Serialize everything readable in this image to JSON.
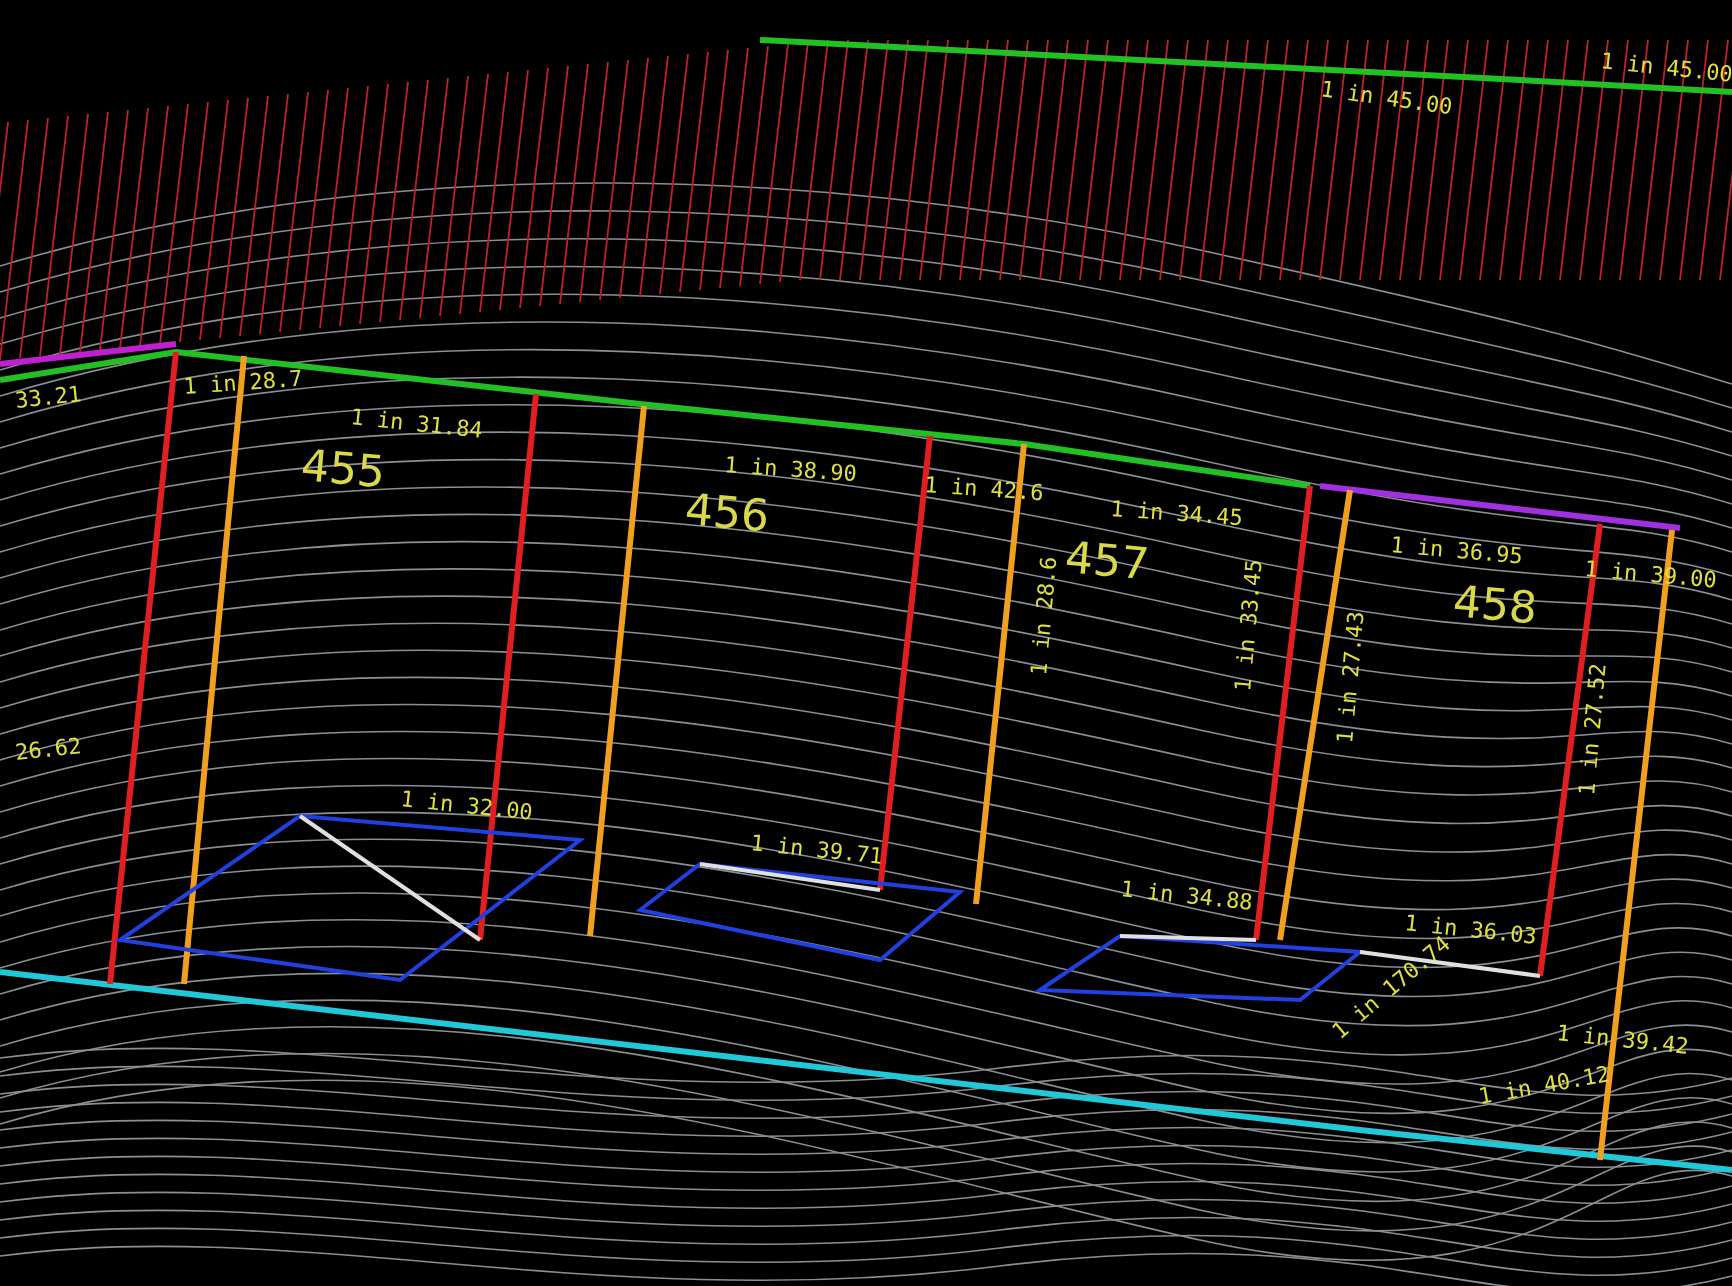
{
  "lot_numbers": [
    "455",
    "456",
    "457",
    "458"
  ],
  "grade_labels": [
    {
      "text": "1 in 45.00"
    },
    {
      "text": "1 in 45.00"
    },
    {
      "text": "33.21"
    },
    {
      "text": "1 in 28.7"
    },
    {
      "text": "1 in 31.84"
    },
    {
      "text": "1 in 38.90"
    },
    {
      "text": "1 in 42.6"
    },
    {
      "text": "1 in 34.45"
    },
    {
      "text": "1 in 36.95"
    },
    {
      "text": "1 in 39.00"
    },
    {
      "text": "26.62"
    },
    {
      "text": "1 in 32.00"
    },
    {
      "text": "1 in 39.71"
    },
    {
      "text": "1 in 34.88"
    },
    {
      "text": "1 in 36.03"
    },
    {
      "text": "1 in 39.42"
    },
    {
      "text": "1 in 33.45"
    },
    {
      "text": "1 in 27.43"
    },
    {
      "text": "1 in 27.52"
    },
    {
      "text": "1 in 28.6"
    },
    {
      "text": "1 in 170.74"
    },
    {
      "text": "1 in 40.12"
    }
  ]
}
